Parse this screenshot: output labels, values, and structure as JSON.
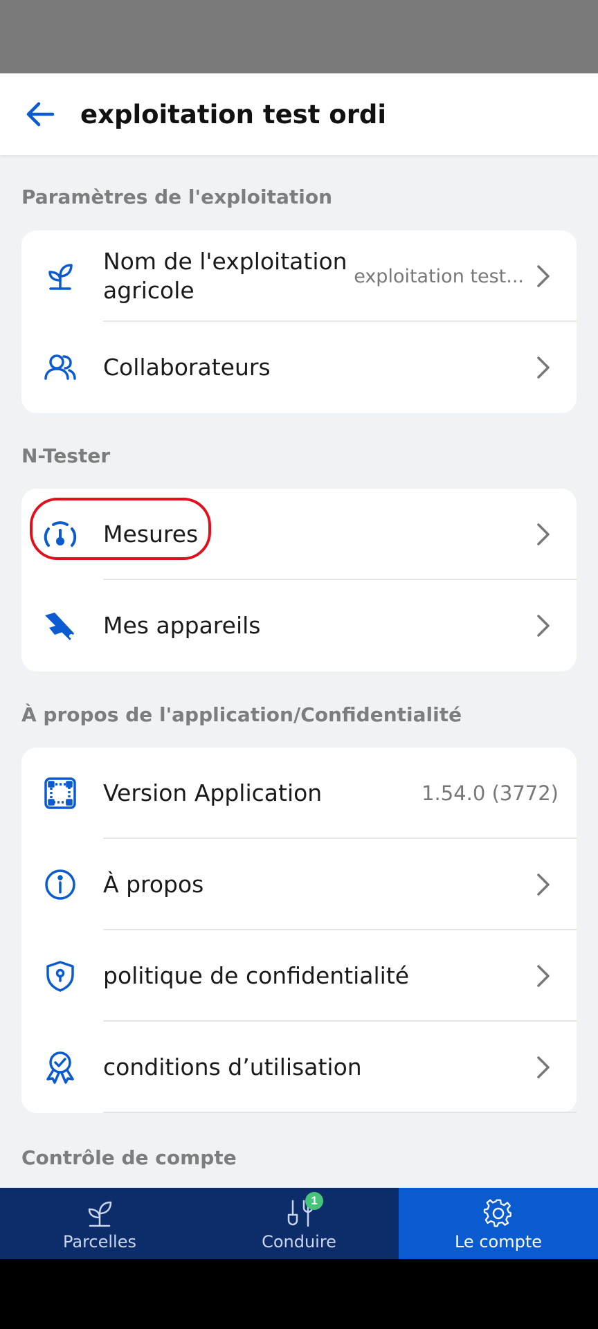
{
  "header": {
    "title": "exploitation test ordi"
  },
  "sections": [
    {
      "title": "Paramètres de l'exploitation",
      "rows": [
        {
          "label_line1": "Nom de l'exploitation",
          "label_line2": "agricole",
          "value": "exploitation test...",
          "icon": "sprout-icon"
        },
        {
          "label": "Collaborateurs",
          "icon": "users-icon"
        }
      ]
    },
    {
      "title": "N-Tester",
      "rows": [
        {
          "label": "Mesures",
          "icon": "gauge-icon"
        },
        {
          "label": "Mes appareils",
          "icon": "device-icon"
        }
      ]
    },
    {
      "title": "À propos de l'application/Confidentialité",
      "rows": [
        {
          "label": "Version Application",
          "value": "1.54.0 (3772)",
          "icon": "app-frame-icon"
        },
        {
          "label": "À propos",
          "icon": "info-icon"
        },
        {
          "label": "politique de confidentialité",
          "icon": "shield-lock-icon"
        },
        {
          "label": "conditions d’utilisation",
          "icon": "badge-check-icon"
        }
      ]
    },
    {
      "title": "Contrôle de compte"
    }
  ],
  "nav": {
    "items": [
      {
        "label": "Parcelles",
        "icon": "plant-icon"
      },
      {
        "label": "Conduire",
        "icon": "tools-icon",
        "badge": "1"
      },
      {
        "label": "Le compte",
        "icon": "gear-icon"
      }
    ],
    "active_index": 2
  },
  "colors": {
    "accent": "#0a5bd0",
    "nav_bg": "#0c2c6a",
    "highlight": "#e0101c",
    "badge": "#45c47a"
  }
}
